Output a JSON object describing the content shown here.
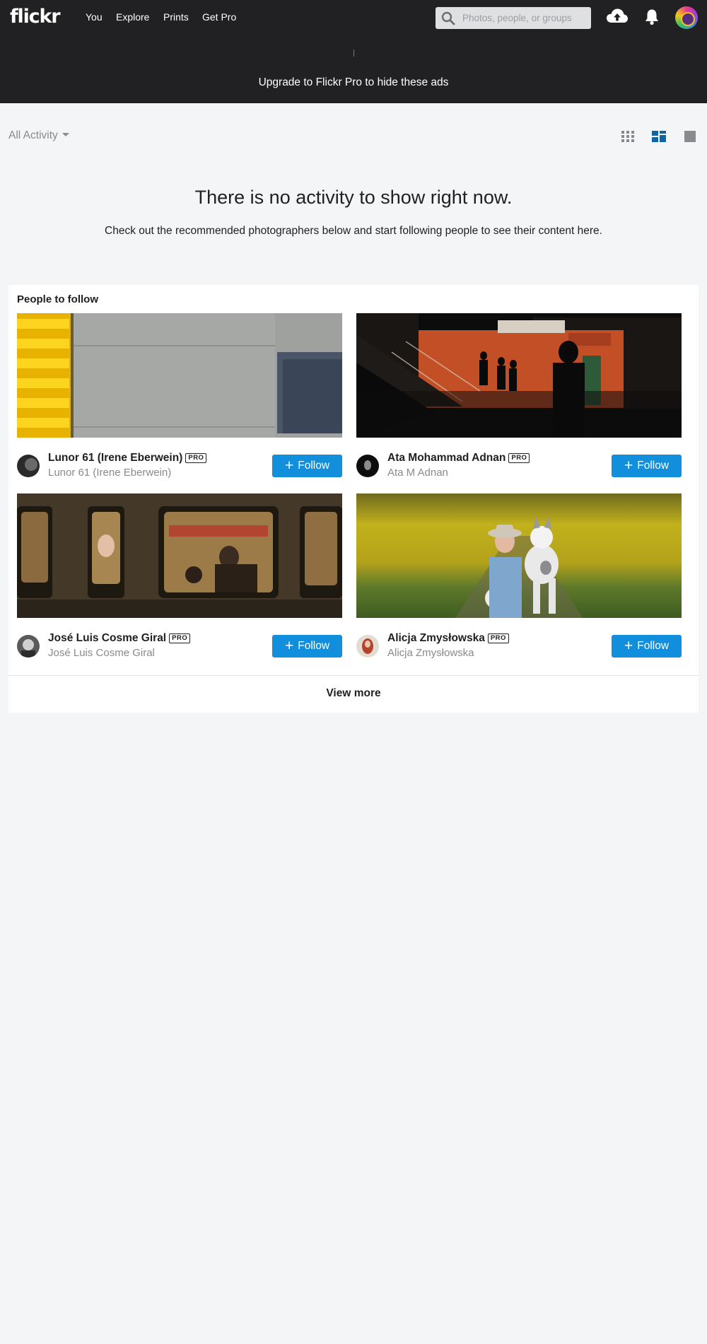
{
  "nav": {
    "logo": "flickr",
    "links": [
      "You",
      "Explore",
      "Prints",
      "Get Pro"
    ],
    "search_placeholder": "Photos, people, or groups"
  },
  "ad": {
    "text": "Upgrade to Flickr Pro to hide these ads"
  },
  "activity": {
    "filter_label": "All Activity",
    "view_modes": [
      "grid-view-icon",
      "medium-view-icon",
      "large-view-icon"
    ],
    "active_view": "medium-view-icon",
    "empty_title": "There is no activity to show right now.",
    "empty_subtitle": "Check out the recommended photographers below and start following people to see their content here."
  },
  "people_to_follow": {
    "title": "People to follow",
    "follow_label": "Follow",
    "pro_badge": "PRO",
    "people": [
      {
        "name": "Lunor 61 (Irene Eberwein)",
        "username": "Lunor 61 (Irene Eberwein)",
        "pro": true
      },
      {
        "name": "Ata Mohammad Adnan",
        "username": "Ata M Adnan",
        "pro": true
      },
      {
        "name": "José Luis Cosme Giral",
        "username": "José Luis Cosme Giral",
        "pro": true
      },
      {
        "name": "Alicja Zmysłowska",
        "username": "Alicja Zmysłowska",
        "pro": true
      }
    ],
    "view_more_label": "View more"
  },
  "colors": {
    "topbar": "#212124",
    "page_bg": "#f3f5f6",
    "follow_button": "#128fdc",
    "active_view_icon": "#0d65a5"
  }
}
